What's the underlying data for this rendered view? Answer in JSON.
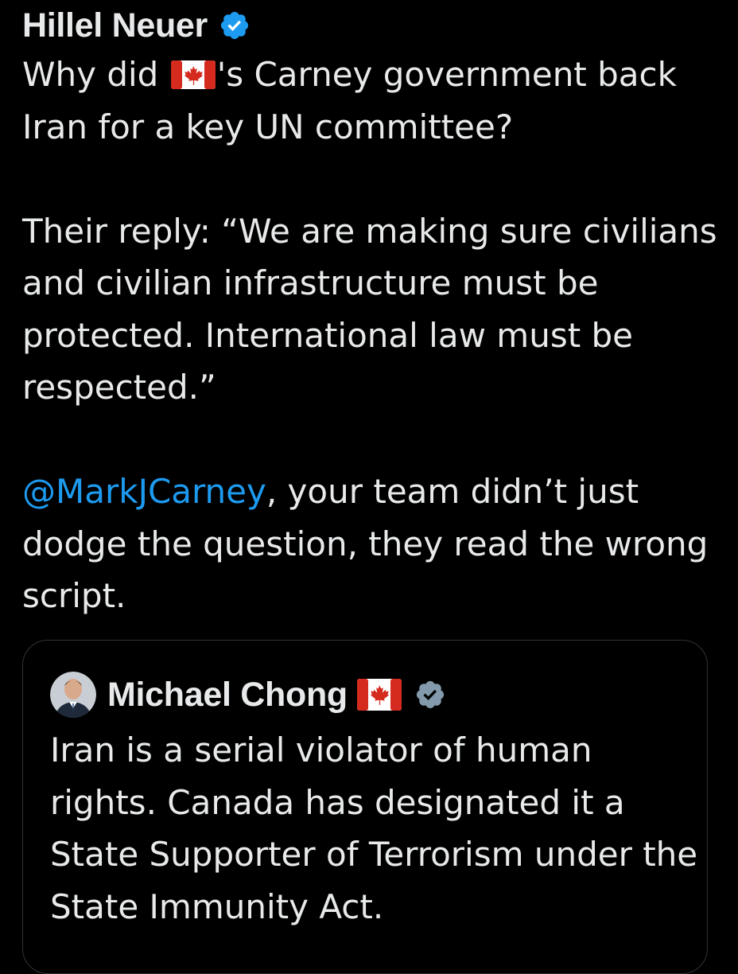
{
  "tweet": {
    "author": {
      "name": "Hillel Neuer",
      "verified_icon": "verified-badge-icon"
    },
    "paragraph1": {
      "pre_flag": "Why did ",
      "flag_icon": "canada-flag-icon",
      "post_flag": "'s Carney government back Iran for a key UN committee?"
    },
    "paragraph2": "Their reply: “We are making sure civilians and civilian infrastructure must be protected. International law must be respected.”",
    "paragraph3": {
      "mention": "@MarkJCarney",
      "rest": ", your team didn’t just dodge the question, they read the wrong script."
    }
  },
  "quoted_tweet": {
    "author": {
      "name": "Michael Chong",
      "flag_icon": "canada-flag-icon",
      "verified_icon": "verified-badge-icon"
    },
    "text": "Iran is a serial violator of human rights. Canada has designated it a State Supporter of Terrorism under the State Immunity Act."
  },
  "colors": {
    "background": "#000000",
    "text": "#e7e9ea",
    "link": "#1d9bf0",
    "verified": "#1d9bf0",
    "card_border": "#2f3336",
    "flag_red": "#d52b1e"
  }
}
